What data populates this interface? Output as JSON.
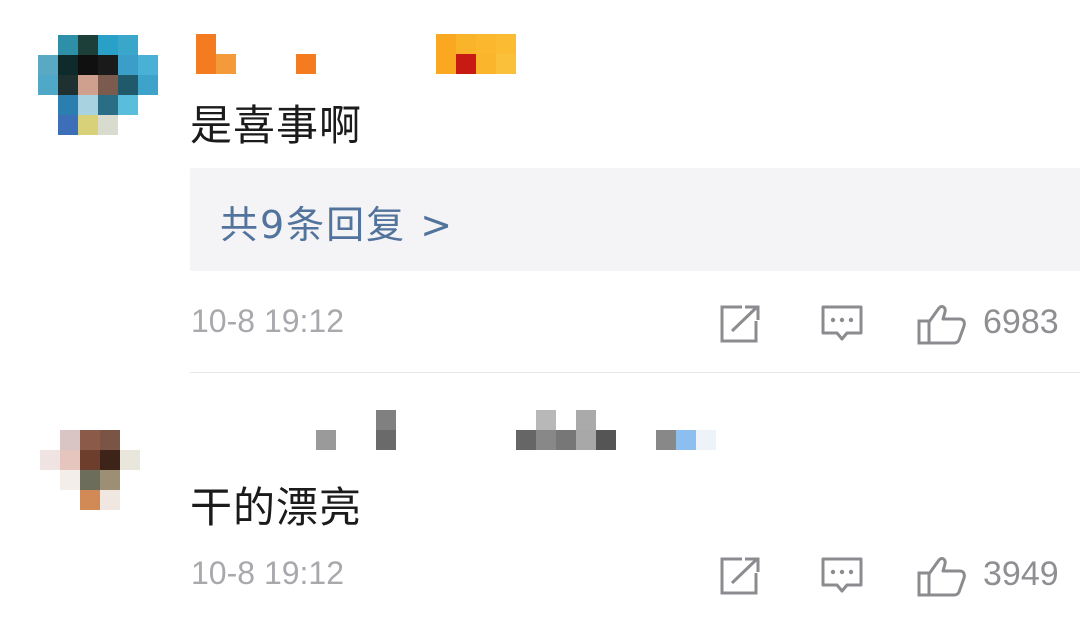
{
  "comments": [
    {
      "text": "是喜事啊",
      "replies_label": "共9条回复 >",
      "timestamp": "10-8 19:12",
      "like_count": "6983"
    },
    {
      "text": "干的漂亮",
      "timestamp": "10-8 19:12",
      "like_count": "3949"
    }
  ],
  "icons": {
    "share": "share-icon",
    "reply": "comment-icon",
    "like": "thumbs-up-icon"
  },
  "colors": {
    "link": "#52739b",
    "meta_text": "#a9a9ad",
    "reply_box_bg": "#f4f4f6"
  }
}
